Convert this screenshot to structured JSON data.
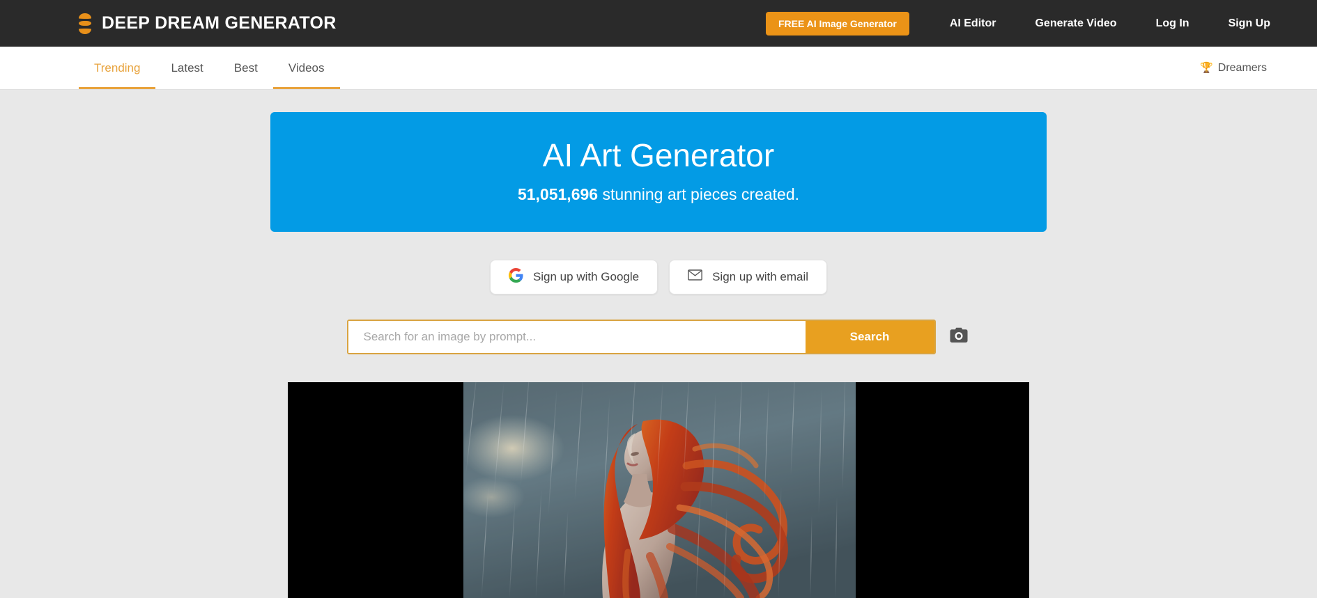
{
  "header": {
    "brand": "DEEP DREAM GENERATOR",
    "logo_icon": "stacked-bars-logo-icon",
    "cta_label": "FREE AI Image Generator",
    "cta_color": "#eb9317",
    "nav_links": [
      {
        "label": "AI Editor"
      },
      {
        "label": "Generate Video"
      },
      {
        "label": "Log In"
      },
      {
        "label": "Sign Up"
      }
    ]
  },
  "subnav": {
    "tabs": [
      {
        "label": "Trending",
        "active": true
      },
      {
        "label": "Latest",
        "active": false
      },
      {
        "label": "Best",
        "active": false
      },
      {
        "label": "Videos",
        "active": false
      }
    ],
    "dreamers": {
      "label": "Dreamers",
      "icon": "trophy-icon"
    },
    "accent_color": "#e8a33d"
  },
  "hero": {
    "title": "AI Art Generator",
    "count": "51,051,696",
    "subtitle_rest": " stunning art pieces created.",
    "background_color": "#039be5"
  },
  "signup": {
    "google_label": "Sign up with Google",
    "google_icon": "google-g-icon",
    "email_label": "Sign up with email",
    "email_icon": "envelope-icon"
  },
  "search": {
    "placeholder": "Search for an image by prompt...",
    "value": "",
    "button_label": "Search",
    "button_color": "#e8a020",
    "camera_icon": "camera-icon"
  },
  "featured": {
    "alt": "AI generated portrait of a woman with flowing red hair standing in the rain",
    "letterbox_color": "#000000"
  }
}
